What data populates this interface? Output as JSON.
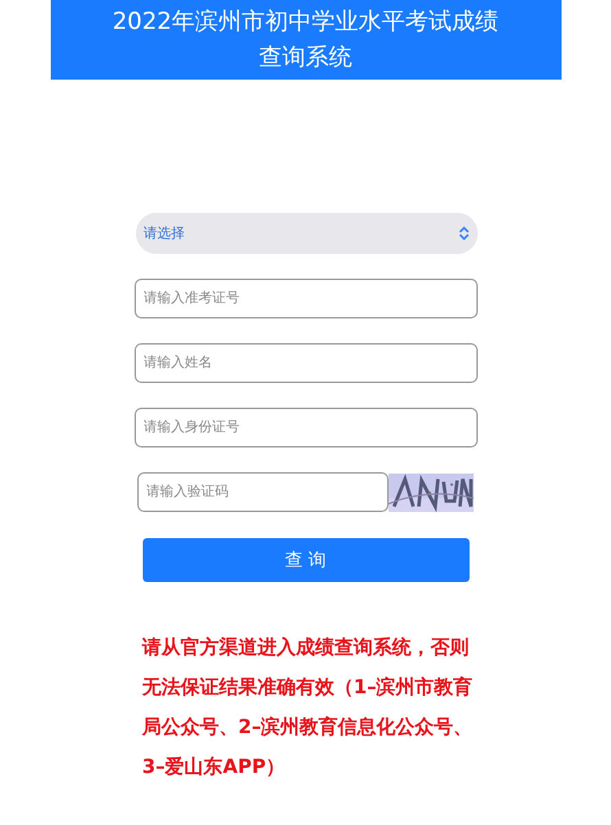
{
  "header": {
    "title_lines": [
      "2022年滨州市初中学业水平考试成绩",
      "查询系统"
    ]
  },
  "select": {
    "value": "请选择"
  },
  "fields": [
    {
      "placeholder": "请输入准考证号"
    },
    {
      "placeholder": "请输入姓名"
    },
    {
      "placeholder": "请输入身份证号"
    }
  ],
  "captcha": {
    "placeholder": "请输入验证码"
  },
  "submit_button": "查 询",
  "notice": "请从官方渠道进入成绩查询系统，否则无法保证结果准确有效（1–滨州市教育局公众号、2–滨州教育信息化公众号、3–爱山东APP）"
}
